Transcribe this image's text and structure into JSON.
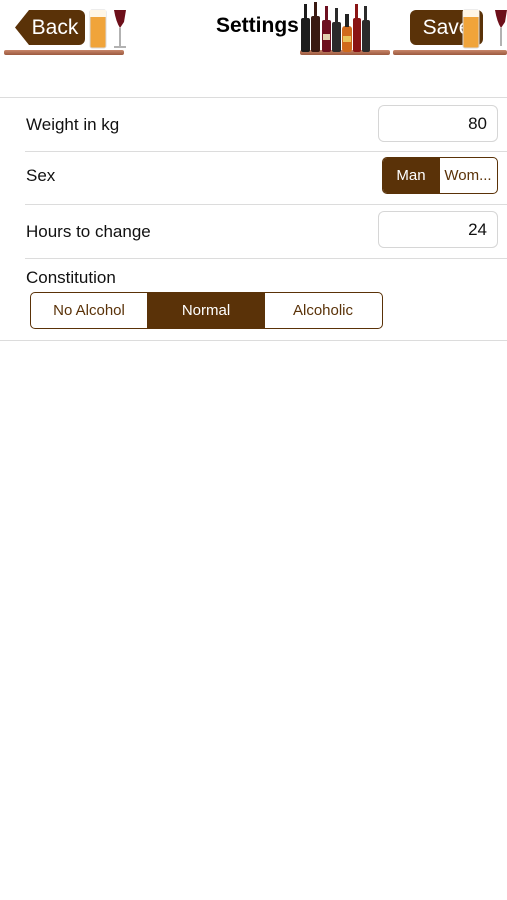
{
  "nav": {
    "title": "Settings",
    "back_label": "Back",
    "save_label": "Save"
  },
  "form": {
    "weight": {
      "label": "Weight in kg",
      "value": "80"
    },
    "sex": {
      "label": "Sex",
      "options": [
        "Man",
        "Wom..."
      ],
      "selected": "Man"
    },
    "hours": {
      "label": "Hours to change",
      "value": "24"
    },
    "constitution": {
      "label": "Constitution",
      "options": [
        "No Alcohol",
        "Normal",
        "Alcoholic"
      ],
      "selected": "Normal"
    }
  },
  "colors": {
    "accent": "#5a3208",
    "divider": "#dcdcdc",
    "shelf": "#b8705a"
  },
  "icons": [
    "beer-glass-icon",
    "wine-glass-icon",
    "bottles-icon"
  ]
}
